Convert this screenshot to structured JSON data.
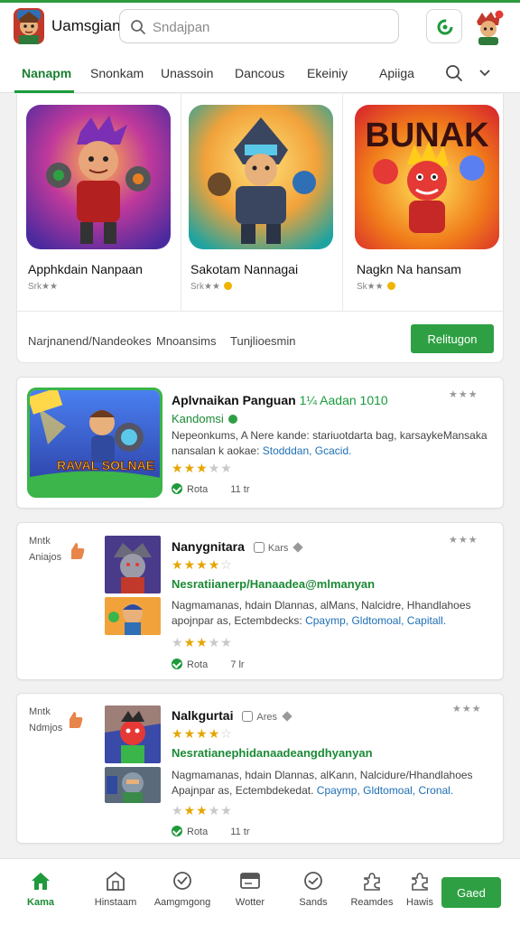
{
  "header": {
    "app_title": "Uamsgian",
    "search_placeholder": "Sndajpan"
  },
  "tabs": [
    "Nanapm",
    "Snonkam",
    "Unassoin",
    "Dancous",
    "Ekeiniy",
    "Apiiga"
  ],
  "featured": {
    "games": [
      {
        "name": "Apphkdain Nanpaan",
        "rating": "Srk★★"
      },
      {
        "name": "Sakotam Nannagai",
        "rating": "Srk★★"
      },
      {
        "name": "Nagkn Na hansam",
        "rating": "Sk★★"
      }
    ],
    "links": [
      "Narjnanend/Nandeokes",
      "Mnoansims",
      "Tunjlioesmin"
    ],
    "button_label": "Relitugon",
    "banner_text": "BUNAK"
  },
  "cards": [
    {
      "title": "Aplvnaikan Panguan",
      "title_suffix": "1¼ Aadan 1010",
      "subtitle": "Kandomsi",
      "description": "Nepeonkums, A Nere kande: stariuotdarta bag, karsaykeMansaka nansalan k aokae:",
      "desc_links": "Stodddan, Gcacid.",
      "stars_corner": "★★★",
      "rating_stars": 3.5,
      "meta_label": "Rota",
      "meta_value": "11 tr",
      "art_text": "RAVAL SOLNAE"
    },
    {
      "side_label": "Mntk Aniajos",
      "title": "Nanygnitara",
      "title_tag": "Kars",
      "subtitle": "Nesratiianerp/Hanaadea@mlmanyan",
      "header_stars": 3.5,
      "description": "Nagmamanas, hdain Dlannas, alMans, Nalcidre, Hhandlahoes apojnpar as, Ectembdecks:",
      "desc_links": "Cpaymp, Gldtomoal, Capitall.",
      "stars_corner": "★★★",
      "rating_stars": 3.5,
      "meta_label": "Rota",
      "meta_value": "7 lr"
    },
    {
      "side_label": "Mntk Ndmjos",
      "title": "Nalkgurtai",
      "title_tag": "Ares",
      "subtitle": "Nesratianephidanaadeangdhyanyan",
      "header_stars": 3.5,
      "description": "Nagmamanas, hdain Dlannas, alKann, Nalcidure/Hhandlahoes Apajnpar as, Ectembdekedat.",
      "desc_links": "Cpaymp, Gldtomoal, Cronal.",
      "stars_corner": "★★★",
      "rating_stars": 3.5,
      "meta_label": "Rota",
      "meta_value": "11 tr"
    }
  ],
  "bottom_nav": {
    "items": [
      "Kama",
      "Hinstaam",
      "Aamgmgong",
      "Wotter",
      "Sands",
      "Reamdes",
      "Hawis"
    ],
    "button_label": "Gaed"
  },
  "colors": {
    "accent": "#2ea043",
    "accent_dark": "#1a7f32",
    "star": "#e6a500",
    "link": "#1f6fb5"
  }
}
